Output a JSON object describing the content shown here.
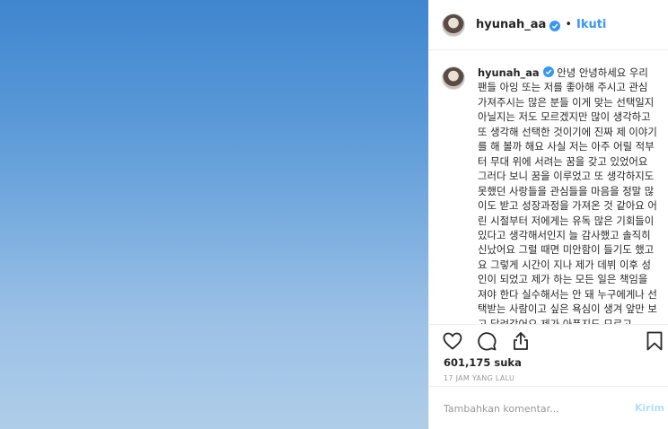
{
  "post": {
    "username": "hyunah_aa",
    "follow_label": "Ikuti",
    "separator": "•"
  },
  "caption": {
    "username": "hyunah_aa",
    "text": "안녕 안녕하세요 우리 팬들 아잉 또는 저를 좋아해 주시고 관심 가져주시는 많은 분들 이게 맞는 선택일지 아닐지는 저도 모르겠지만 많이 생각하고 또 생각해 선택한 것이기에 진짜 제 이야기를 해 볼까 해요 사실 저는 아주 어릴 적부터 무대 위에 서려는 꿈을 갖고 있었어요 그러다 보니 꿈을 이루었고 또 생각하지도 못했던 사랑들을 관심들을 마음을 정말 많이도 받고 성장과정을 가져온 것 같아요 어린 시절부터 저에게는 유독 많은 기회들이 있다고 생각해서인지 늘 감사했고 솔직히 신났어요 그럴 때면 미안함이 들기도 했고요 그렇게 시간이 지나 제가 데뷔 이후 성인이 되었고 제가 하는 모든 일은 책임을 져야 한다 실수해서는 안 돼 누구에게나 선택받는 사람이고 싶은 욕심이 생겨 앞만 보고 달려갔어요 제가 아픈지도 모르고"
  },
  "actions": {
    "like_icon": "heart-icon",
    "comment_icon": "comment-bubble-icon",
    "share_icon": "share-upload-icon",
    "save_icon": "bookmark-icon"
  },
  "likes_text": "601,175 suka",
  "timestamp": "17 JAM YANG LALU",
  "comment_box": {
    "placeholder": "Tambahkan komentar...",
    "submit_label": "Kirim"
  },
  "colors": {
    "accent": "#3897f0",
    "submit_disabled": "#b2dffc",
    "sky_top": "#3f86cf",
    "sky_bottom": "#aecde9"
  }
}
